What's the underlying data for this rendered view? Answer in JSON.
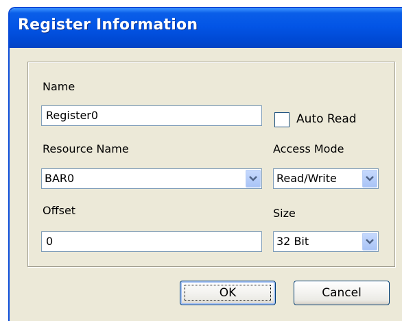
{
  "window": {
    "title": "Register Information"
  },
  "form": {
    "name_label": "Name",
    "name_value": "Register0",
    "auto_read_label": "Auto Read",
    "resource_label": "Resource Name",
    "resource_value": "BAR0",
    "access_label": "Access Mode",
    "access_value": "Read/Write",
    "offset_label": "Offset",
    "offset_value": "0",
    "size_label": "Size",
    "size_value": "32 Bit"
  },
  "buttons": {
    "ok": "OK",
    "cancel": "Cancel"
  }
}
